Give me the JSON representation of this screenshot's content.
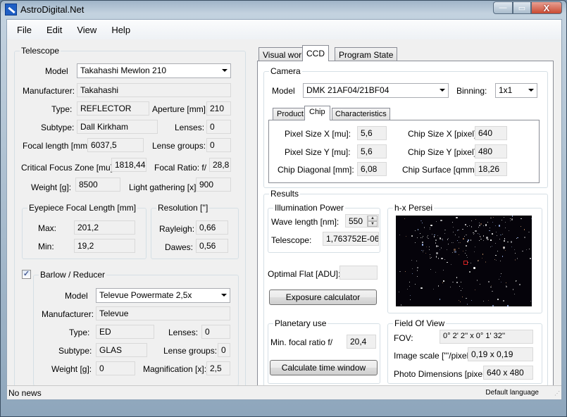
{
  "window": {
    "title": "AstroDigital.Net",
    "controls": {
      "minimize": "—",
      "maximize": "▭",
      "close": "X"
    }
  },
  "menu": [
    "File",
    "Edit",
    "View",
    "Help"
  ],
  "telescope": {
    "group_label": "Telescope",
    "model_label": "Model",
    "model_value": "Takahashi Mewlon 210",
    "manufacturer_label": "Manufacturer:",
    "manufacturer_value": "Takahashi",
    "type_label": "Type:",
    "type_value": "REFLECTOR",
    "aperture_label": "Aperture [mm]:",
    "aperture_value": "210",
    "subtype_label": "Subtype:",
    "subtype_value": "Dall Kirkham",
    "lenses_label": "Lenses:",
    "lenses_value": "0",
    "focal_length_label": "Focal length [mm]:",
    "focal_length_value": "6037,5",
    "lense_groups_label": "Lense groups:",
    "lense_groups_value": "0",
    "cfz_label": "Critical Focus Zone [mu]:",
    "cfz_value": "1818,44",
    "focal_ratio_label": "Focal Ratio:  f/",
    "focal_ratio_value": "28,8",
    "weight_label": "Weight [g]:",
    "weight_value": "8500",
    "light_label": "Light gathering [x]:",
    "light_value": "900",
    "eyepiece": {
      "group_label": "Eyepiece Focal Length [mm]",
      "max_label": "Max:",
      "max_value": "201,2",
      "min_label": "Min:",
      "min_value": "19,2"
    },
    "resolution": {
      "group_label": "Resolution ['']",
      "rayleigh_label": "Rayleigh:",
      "rayleigh_value": "0,66",
      "dawes_label": "Dawes:",
      "dawes_value": "0,56"
    }
  },
  "barlow": {
    "checked": true,
    "check_glyph": "✓",
    "group_label": "Barlow / Reducer",
    "model_label": "Model",
    "model_value": "Televue Powermate 2,5x",
    "manufacturer_label": "Manufacturer:",
    "manufacturer_value": "Televue",
    "type_label": "Type:",
    "type_value": "ED",
    "lenses_label": "Lenses:",
    "lenses_value": "0",
    "subtype_label": "Subtype:",
    "subtype_value": "GLAS",
    "lense_groups_label": "Lense groups:",
    "lense_groups_value": "0",
    "weight_label": "Weight [g]:",
    "weight_value": "0",
    "magnification_label": "Magnification [x]:",
    "magnification_value": "2,5"
  },
  "tabs": {
    "items": [
      "Visual work",
      "CCD",
      "Program State"
    ],
    "active": "CCD"
  },
  "camera": {
    "group_label": "Camera",
    "model_label": "Model",
    "model_value": "DMK 21AF04/21BF04",
    "binning_label": "Binning:",
    "binning_value": "1x1",
    "subtabs": [
      "Product",
      "Chip",
      "Characteristics"
    ],
    "active_subtab": "Chip",
    "chip": {
      "pixel_x_label": "Pixel Size X [mu]:",
      "pixel_x_value": "5,6",
      "pixel_y_label": "Pixel Size Y [mu]:",
      "pixel_y_value": "5,6",
      "diagonal_label": "Chip Diagonal [mm]:",
      "diagonal_value": "6,08",
      "size_x_label": "Chip Size X [pixel]:",
      "size_x_value": "640",
      "size_y_label": "Chip Size Y [pixel]:",
      "size_y_value": "480",
      "surface_label": "Chip Surface [qmm]:",
      "surface_value": "18,26"
    }
  },
  "results": {
    "group_label": "Results",
    "illumination": {
      "group_label": "Illumination Power",
      "wavelength_label": "Wave length [nm]:",
      "wavelength_value": "550",
      "telescope_label": "Telescope:",
      "telescope_value": "1,763752E-06"
    },
    "optimal_flat_label": "Optimal Flat [ADU]:",
    "optimal_flat_value": "",
    "exposure_button": "Exposure calculator",
    "image": {
      "group_label": "h-x Persei"
    },
    "planetary": {
      "group_label": "Planetary use",
      "min_focal_label": "Min. focal ratio f/",
      "min_focal_value": "20,4",
      "calc_button": "Calculate time window"
    },
    "fov": {
      "group_label": "Field Of View",
      "fov_label": "FOV:",
      "fov_value": "0° 2' 2''  x 0° 1' 32''",
      "scale_label": "Image scale ['''/pixel]:",
      "scale_value": "0,19 x 0,19",
      "photo_label": "Photo Dimensions [pixel]:",
      "photo_value": "640 x 480"
    }
  },
  "status": {
    "left": "No news",
    "right": "Default language"
  }
}
